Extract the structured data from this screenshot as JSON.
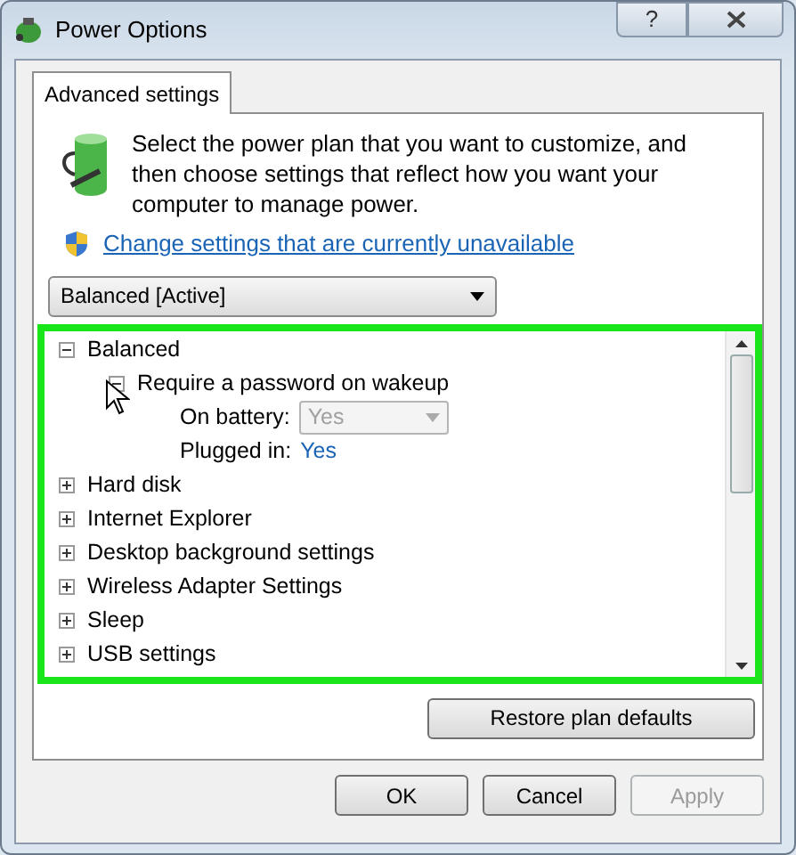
{
  "window": {
    "title": "Power Options",
    "help": "?"
  },
  "tabs": [
    {
      "label": "Advanced settings",
      "selected": true
    }
  ],
  "intro": "Select the power plan that you want to customize, and then choose settings that reflect how you want your computer to manage power.",
  "link": "Change settings that are currently unavailable",
  "plan_dropdown": {
    "value": "Balanced [Active]"
  },
  "tree": [
    {
      "label": "Balanced",
      "expanded": true,
      "children": [
        {
          "label": "Require a password on wakeup",
          "expanded": true,
          "children": [
            {
              "kind": "dropdown",
              "label": "On battery:",
              "value": "Yes",
              "disabled": true
            },
            {
              "kind": "link",
              "label": "Plugged in:",
              "value": "Yes"
            }
          ]
        }
      ]
    },
    {
      "label": "Hard disk",
      "expanded": false
    },
    {
      "label": "Internet Explorer",
      "expanded": false
    },
    {
      "label": "Desktop background settings",
      "expanded": false
    },
    {
      "label": "Wireless Adapter Settings",
      "expanded": false
    },
    {
      "label": "Sleep",
      "expanded": false
    },
    {
      "label": "USB settings",
      "expanded": false
    }
  ],
  "restore_button": "Restore plan defaults",
  "buttons": [
    {
      "label": "OK",
      "disabled": false
    },
    {
      "label": "Cancel",
      "disabled": false
    },
    {
      "label": "Apply",
      "disabled": true
    }
  ]
}
